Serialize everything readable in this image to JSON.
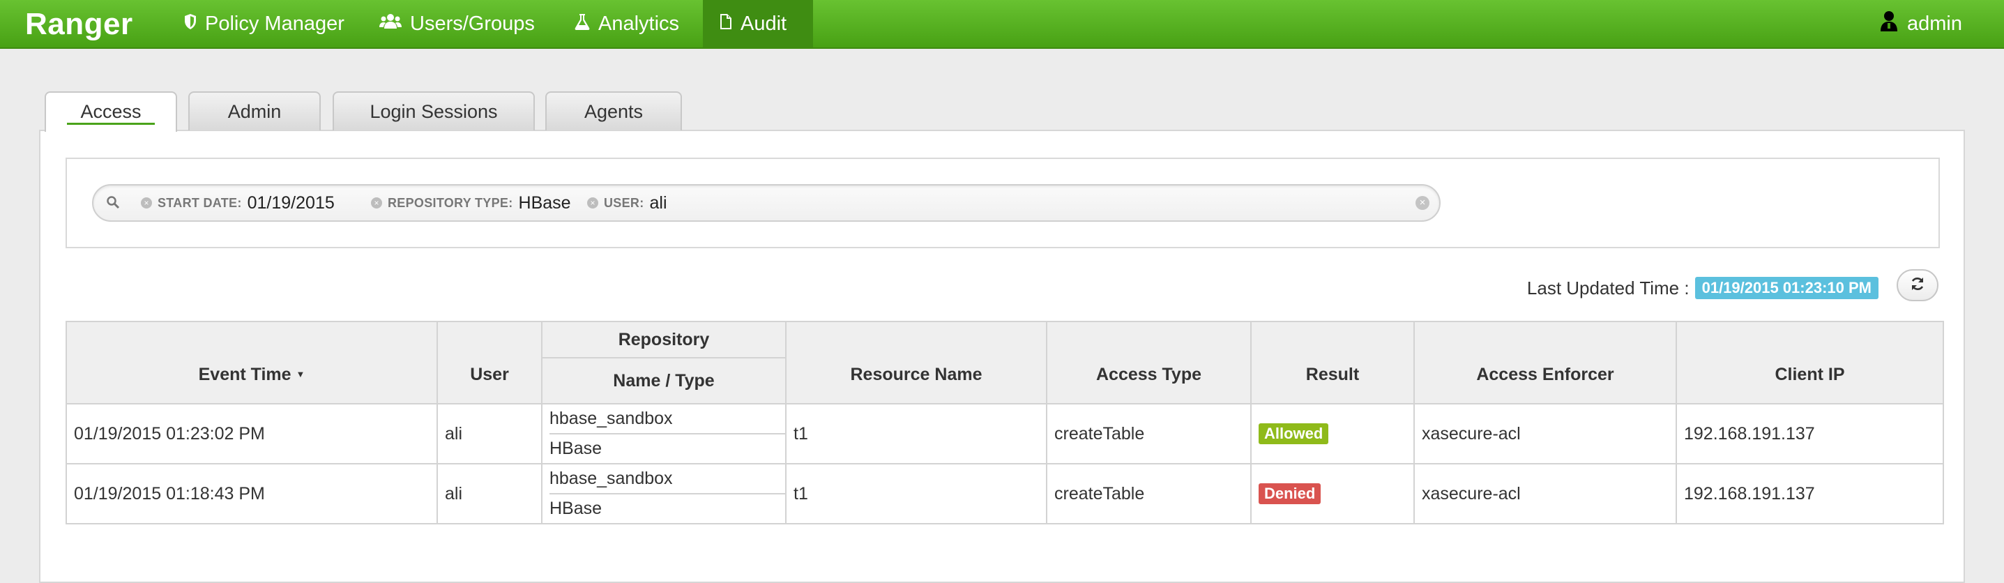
{
  "navbar": {
    "brand": "Ranger",
    "items": [
      {
        "label": "Policy Manager",
        "icon": "shield-icon"
      },
      {
        "label": "Users/Groups",
        "icon": "users-icon"
      },
      {
        "label": "Analytics",
        "icon": "flask-icon"
      },
      {
        "label": "Audit",
        "icon": "file-icon",
        "active": true
      }
    ],
    "user": {
      "label": "admin",
      "icon": "user-icon"
    }
  },
  "tabs": [
    {
      "label": "Access",
      "active": true
    },
    {
      "label": "Admin"
    },
    {
      "label": "Login Sessions"
    },
    {
      "label": "Agents"
    }
  ],
  "search": {
    "facets": [
      {
        "category": "START DATE:",
        "value": "01/19/2015"
      },
      {
        "category": "REPOSITORY TYPE:",
        "value": "HBase"
      },
      {
        "category": "USER:",
        "value": "ali"
      }
    ]
  },
  "last_updated": {
    "label": "Last Updated Time :",
    "value": "01/19/2015 01:23:10 PM"
  },
  "table": {
    "headers": {
      "event_time": "Event Time",
      "user": "User",
      "repository": "Repository",
      "name_type": "Name / Type",
      "resource_name": "Resource Name",
      "access_type": "Access Type",
      "result": "Result",
      "access_enforcer": "Access Enforcer",
      "client_ip": "Client IP"
    },
    "rows": [
      {
        "event_time": "01/19/2015 01:23:02 PM",
        "user": "ali",
        "repo_name": "hbase_sandbox",
        "repo_type": "HBase",
        "resource_name": "t1",
        "access_type": "createTable",
        "result": "Allowed",
        "access_enforcer": "xasecure-acl",
        "client_ip": "192.168.191.137"
      },
      {
        "event_time": "01/19/2015 01:18:43 PM",
        "user": "ali",
        "repo_name": "hbase_sandbox",
        "repo_type": "HBase",
        "resource_name": "t1",
        "access_type": "createTable",
        "result": "Denied",
        "access_enforcer": "xasecure-acl",
        "client_ip": "192.168.191.137"
      }
    ]
  },
  "colors": {
    "navbar_green": "#48a114",
    "allowed": "#8fba1a",
    "denied": "#d9534f",
    "time_badge": "#5bc0de"
  }
}
